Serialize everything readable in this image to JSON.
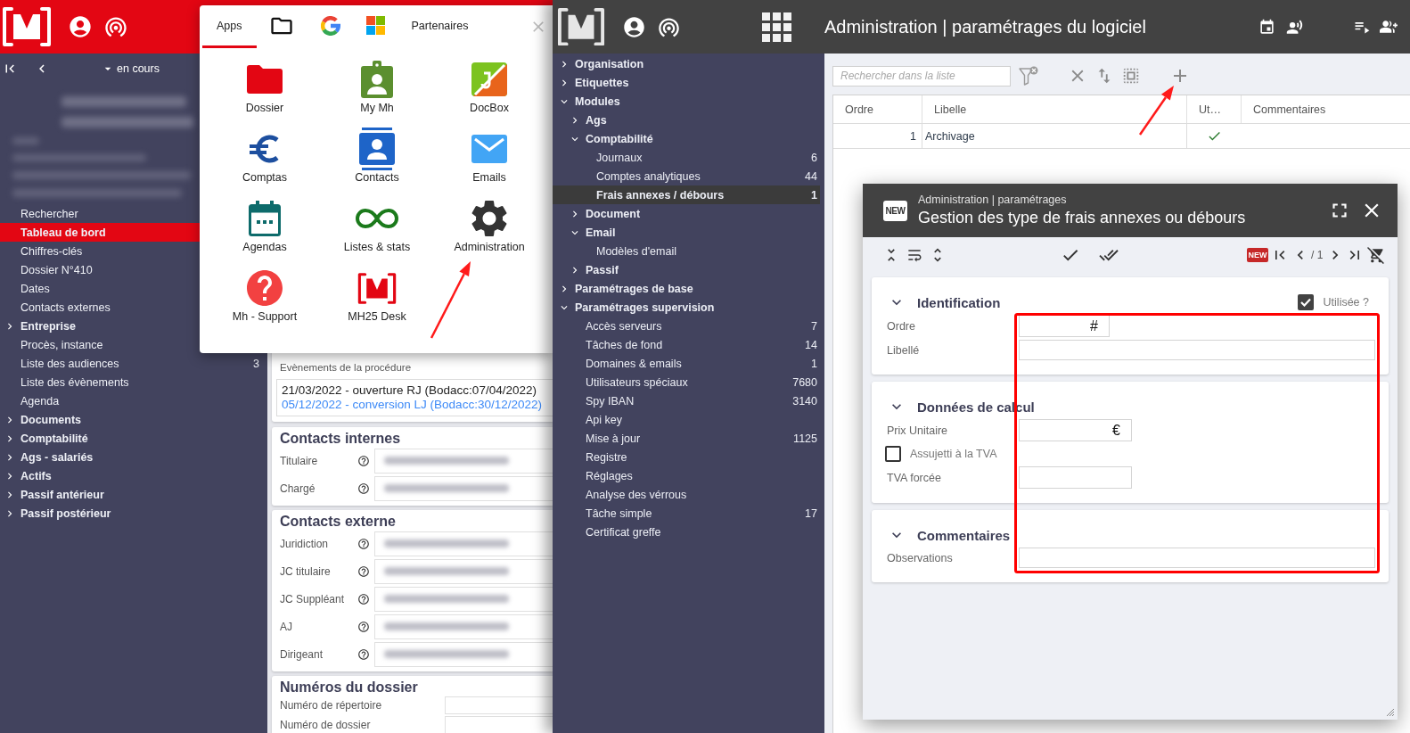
{
  "case_window": {
    "status_filter": "en cours",
    "menu": [
      {
        "kind": "item",
        "label": "Rechercher",
        "selected": false
      },
      {
        "kind": "item",
        "label": "Tableau de bord",
        "selected": true
      },
      {
        "kind": "item",
        "label": "Chiffres-clés",
        "selected": false
      },
      {
        "kind": "item",
        "label": "Dossier N°410",
        "selected": false
      },
      {
        "kind": "item",
        "label": "Dates",
        "selected": false
      },
      {
        "kind": "item",
        "label": "Contacts externes",
        "selected": false
      },
      {
        "kind": "group",
        "label": "Entreprise",
        "selected": false,
        "expanded": false
      },
      {
        "kind": "item",
        "label": "Procès, instance",
        "selected": false
      },
      {
        "kind": "item",
        "label": "Liste des audiences",
        "count": "3",
        "selected": false
      },
      {
        "kind": "item",
        "label": "Liste des évènements",
        "selected": false
      },
      {
        "kind": "item",
        "label": "Agenda",
        "selected": false
      },
      {
        "kind": "group",
        "label": "Documents",
        "selected": false,
        "expanded": false
      },
      {
        "kind": "group",
        "label": "Comptabilité",
        "selected": false,
        "expanded": false
      },
      {
        "kind": "group",
        "label": "Ags - salariés",
        "selected": false,
        "expanded": false
      },
      {
        "kind": "group",
        "label": "Actifs",
        "selected": false,
        "expanded": false
      },
      {
        "kind": "group",
        "label": "Passif antérieur",
        "selected": false,
        "expanded": false
      },
      {
        "kind": "group",
        "label": "Passif postérieur",
        "selected": false,
        "expanded": false
      }
    ],
    "events": {
      "label": "Evènements de la procédure",
      "lines": [
        {
          "kind": "entry",
          "text": "21/03/2022 - ouverture RJ (Bodacc:07/04/2022)"
        },
        {
          "kind": "link",
          "text": "05/12/2022 - conversion LJ (Bodacc:30/12/2022)"
        }
      ]
    },
    "cards": [
      {
        "kind": "contacts",
        "title": "Contacts internes",
        "rows": [
          {
            "label": "Titulaire"
          },
          {
            "label": "Chargé"
          }
        ]
      },
      {
        "kind": "contacts",
        "title": "Contacts externe",
        "rows": [
          {
            "label": "Juridiction"
          },
          {
            "label": "JC titulaire"
          },
          {
            "label": "JC Suppléant"
          },
          {
            "label": "AJ"
          },
          {
            "label": "Dirigeant"
          }
        ]
      },
      {
        "kind": "numbers",
        "title": "Numéros du dossier",
        "rows": [
          {
            "label": "Numéro de répertoire"
          },
          {
            "label": "Numéro de dossier"
          }
        ]
      }
    ]
  },
  "apps_popup": {
    "tabs": [
      {
        "kind": "text",
        "label": "Apps",
        "selected": true
      },
      {
        "kind": "folder",
        "selected": false
      },
      {
        "kind": "g-logo",
        "selected": false
      },
      {
        "kind": "squares",
        "selected": false
      },
      {
        "kind": "text",
        "label": "Partenaires",
        "selected": false
      }
    ],
    "apps": [
      {
        "kind": "folder",
        "label": "Dossier"
      },
      {
        "kind": "badge",
        "label": "My Mh"
      },
      {
        "kind": "tile",
        "label": "DocBox"
      },
      {
        "kind": "euro",
        "label": "Comptas"
      },
      {
        "kind": "contacts",
        "label": "Contacts"
      },
      {
        "kind": "mail",
        "label": "Emails"
      },
      {
        "kind": "calendar",
        "label": "Agendas"
      },
      {
        "kind": "infinity",
        "label": "Listes & stats"
      },
      {
        "kind": "gear",
        "label": "Administration"
      },
      {
        "kind": "help",
        "label": "Mh - Support"
      },
      {
        "kind": "logo",
        "label": "MH25 Desk"
      }
    ]
  },
  "admin_window": {
    "title": "Administration | paramétrages du logiciel",
    "tree": [
      {
        "kind": "group",
        "label": "Organisation",
        "expanded": false,
        "selected": false
      },
      {
        "kind": "group",
        "label": "Etiquettes",
        "expanded": false,
        "selected": false
      },
      {
        "kind": "group",
        "label": "Modules",
        "expanded": true,
        "selected": false,
        "children": [
          {
            "kind": "group",
            "label": "Ags",
            "expanded": false,
            "selected": false
          },
          {
            "kind": "group",
            "label": "Comptabilité",
            "expanded": true,
            "selected": false,
            "children": [
              {
                "kind": "item",
                "label": "Journaux",
                "count": "6",
                "selected": false
              },
              {
                "kind": "item",
                "label": "Comptes analytiques",
                "count": "44",
                "selected": false
              },
              {
                "kind": "item",
                "label": "Frais annexes / débours",
                "count": "1",
                "selected": true
              }
            ]
          },
          {
            "kind": "group",
            "label": "Document",
            "expanded": false,
            "selected": false
          },
          {
            "kind": "group",
            "label": "Email",
            "expanded": true,
            "selected": false,
            "children": [
              {
                "kind": "item",
                "label": "Modèles d'email",
                "selected": false
              }
            ]
          },
          {
            "kind": "group",
            "label": "Passif",
            "expanded": false,
            "selected": false
          }
        ]
      },
      {
        "kind": "group",
        "label": "Paramétrages de base",
        "expanded": false,
        "selected": false
      },
      {
        "kind": "group",
        "label": "Paramétrages supervision",
        "expanded": true,
        "selected": false,
        "children": [
          {
            "kind": "item",
            "label": "Accès serveurs",
            "count": "7",
            "selected": false
          },
          {
            "kind": "item",
            "label": "Tâches de fond",
            "count": "14",
            "selected": false
          },
          {
            "kind": "item",
            "label": "Domaines & emails",
            "count": "1",
            "selected": false
          },
          {
            "kind": "item",
            "label": "Utilisateurs spéciaux",
            "count": "7680",
            "selected": false
          },
          {
            "kind": "item",
            "label": "Spy IBAN",
            "count": "3140",
            "selected": false
          },
          {
            "kind": "item",
            "label": "Api key",
            "selected": false
          },
          {
            "kind": "item",
            "label": "Mise à jour",
            "count": "1125",
            "selected": false
          },
          {
            "kind": "item",
            "label": "Registre",
            "selected": false
          },
          {
            "kind": "item",
            "label": "Réglages",
            "selected": false
          },
          {
            "kind": "item",
            "label": "Analyse des vérrous",
            "selected": false
          },
          {
            "kind": "item",
            "label": "Tâche simple",
            "count": "17",
            "selected": false
          },
          {
            "kind": "item",
            "label": "Certificat greffe",
            "selected": false
          }
        ]
      }
    ],
    "search": {
      "placeholder": "Rechercher dans la liste"
    },
    "table": {
      "columns": [
        "Ordre",
        "Libelle",
        "Ut…",
        "Commentaires"
      ],
      "rows": [
        {
          "order": "1",
          "label": "Archivage",
          "used": true
        }
      ]
    }
  },
  "dialog": {
    "badge": "NEW",
    "subtitle": "Administration | paramétrages",
    "title": "Gestion des type de frais annexes ou débours",
    "toolbar": {
      "badge": "NEW",
      "pager": "/ 1"
    },
    "sections": [
      {
        "title": "Identification",
        "expanded": true,
        "toggle": {
          "label": "Utilisée ?",
          "checked": true
        },
        "fields": [
          {
            "kind": "number",
            "label": "Ordre",
            "suffix": "#"
          },
          {
            "kind": "text",
            "label": "Libellé"
          }
        ]
      },
      {
        "title": "Données de calcul",
        "expanded": true,
        "fields": [
          {
            "kind": "currency",
            "label": "Prix Unitaire",
            "suffix": "€"
          },
          {
            "kind": "checkbox",
            "label": "Assujetti à la TVA",
            "checked": false
          },
          {
            "kind": "short",
            "label": "TVA forcée"
          }
        ]
      },
      {
        "title": "Commentaires",
        "expanded": true,
        "fields": [
          {
            "kind": "text",
            "label": "Observations"
          }
        ]
      }
    ]
  }
}
